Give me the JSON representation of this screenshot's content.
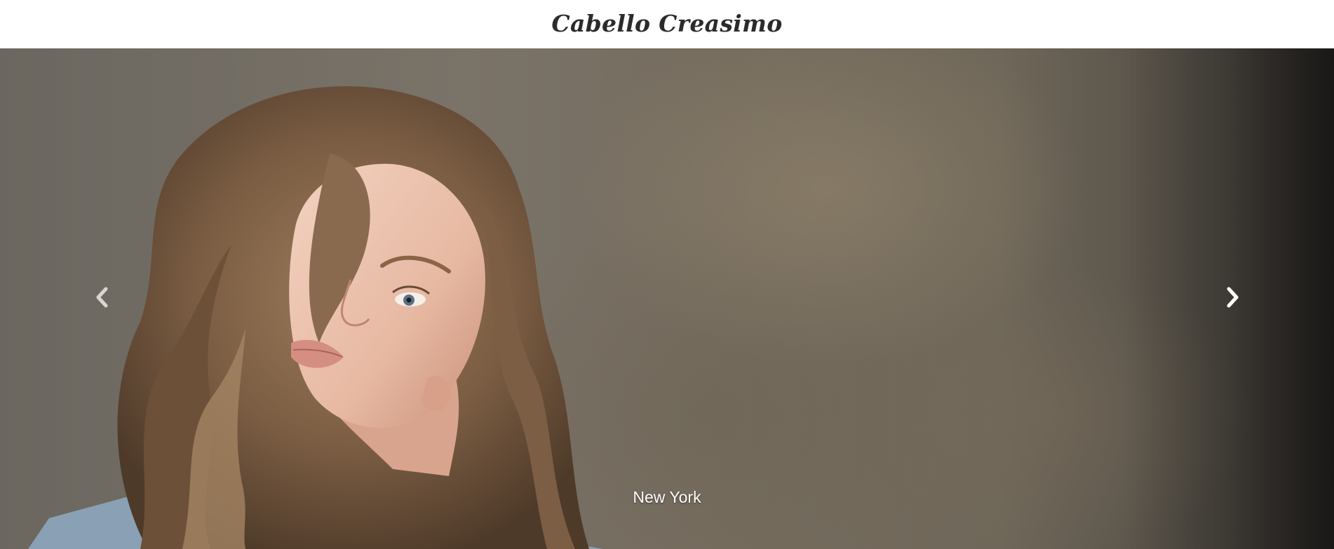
{
  "header": {
    "brand": "Cabello Creasimo"
  },
  "slider": {
    "caption": "New York",
    "prev_icon": "chevron-left-icon",
    "next_icon": "chevron-right-icon",
    "dot_count": 10,
    "active_index": 4,
    "colors": {
      "background": "#75695b",
      "arrow": "#ffffff",
      "caption": "#ffffff"
    }
  }
}
